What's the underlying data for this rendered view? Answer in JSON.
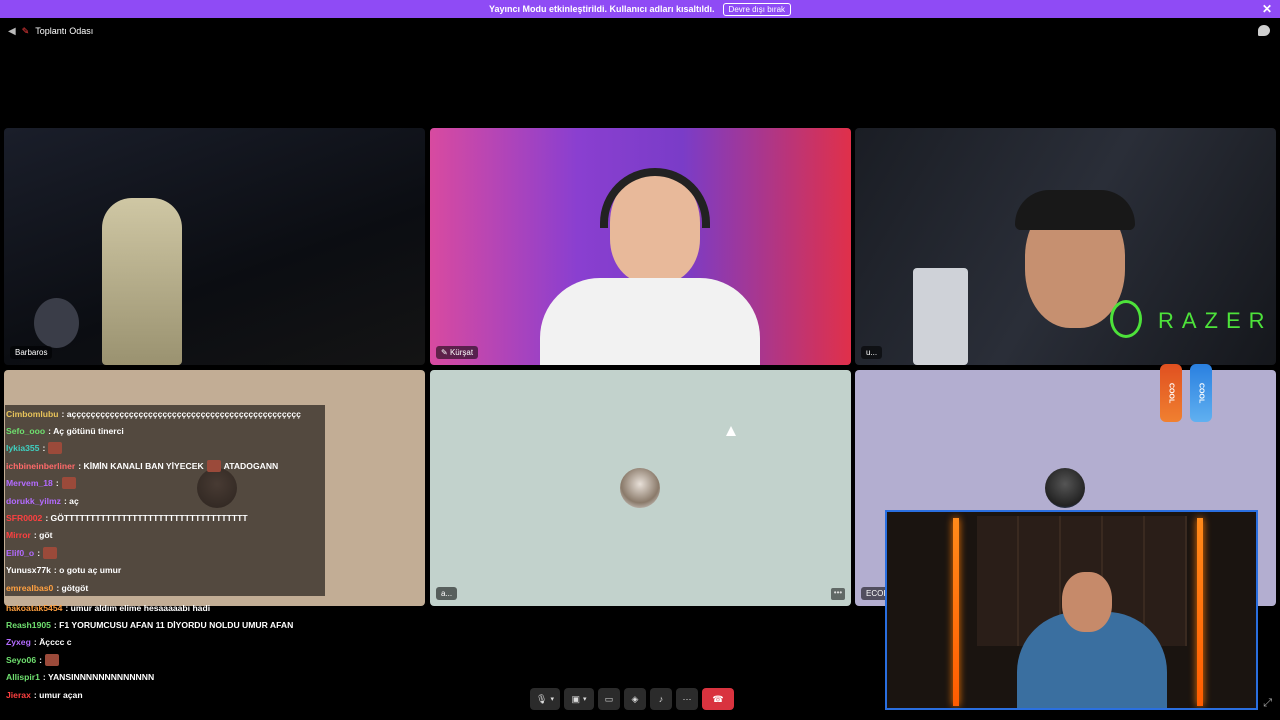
{
  "banner": {
    "text": "Yayıncı Modu etkinleştirildi. Kullanıcı adları kısaltıldı.",
    "button_label": "Devre dışı bırak",
    "color": "#8f4bf5"
  },
  "topbar": {
    "channel_name": "Toplantı Odası",
    "icons": [
      "speaker-muted-icon",
      "pin-icon",
      "chat-icon"
    ]
  },
  "tiles": [
    {
      "name": "Barbaros"
    },
    {
      "name": "Kürşat"
    },
    {
      "name": "u..."
    },
    {
      "name": ""
    },
    {
      "name": "a..."
    },
    {
      "name": "ECOIY"
    }
  ],
  "overlay": {
    "razer_text": "RAZER",
    "can_label_1": "COOL",
    "can_label_2": "COOL"
  },
  "chat_inside": [
    {
      "user": "Cimbomlubu",
      "color": "#e8c35a",
      "msg": ": açççççççççççççççççççççççççççççççççççççççççççççççç"
    },
    {
      "user": "Sefo_ooo",
      "color": "#6fe06f",
      "msg": ": Aç götünü tinerci"
    },
    {
      "user": "lykia355",
      "color": "#3fd0c0",
      "msg": ":",
      "emote": true
    },
    {
      "user": "ichbineinberliner",
      "color": "#ff6a6a",
      "msg": ": KİMİN KANALI BAN YİYECEK",
      "emote": true,
      "msg2": "ATADOGANN"
    },
    {
      "user": "Mervem_18",
      "color": "#b36bff",
      "msg": ":",
      "emote": true
    },
    {
      "user": "dorukk_yilmz",
      "color": "#b36bff",
      "msg": ": aç"
    },
    {
      "user": "SFR0002",
      "color": "#ff4040",
      "msg": ": GÖTTTTTTTTTTTTTTTTTTTTTTTTTTTTTTTTTTT"
    },
    {
      "user": "Mirror",
      "color": "#ff4040",
      "msg": ": göt"
    },
    {
      "user": "Elif0_o",
      "color": "#b36bff",
      "msg": ":",
      "emote": true
    },
    {
      "user": "Yunusx77k",
      "color": "#ffffff",
      "msg": ": o gotu aç umur"
    },
    {
      "user": "emrealbas0",
      "color": "#ffa040",
      "msg": ": götgöt"
    }
  ],
  "chat_outside": [
    {
      "user": "hakoatak5454",
      "color": "#ffa040",
      "msg": ": umur aldım elime hesaaaaabı hadi"
    },
    {
      "user": "Reash1905",
      "color": "#6fe06f",
      "msg": ": F1 YORUMCUSU AFAN 11 DİYORDU NOLDU UMUR AFAN"
    },
    {
      "user": "Zyxeg",
      "color": "#b36bff",
      "msg": ": Äçccc c"
    },
    {
      "user": "Seyo06",
      "color": "#6fe06f",
      "msg": ":",
      "emote": true
    },
    {
      "user": "Allispir1",
      "color": "#6fe06f",
      "msg": ": YANSINNNNNNNNNNNNN"
    },
    {
      "user": "Jierax",
      "color": "#ff4040",
      "msg": ": umur açan"
    }
  ],
  "controls": [
    "microphone-icon",
    "chevron-icon",
    "camera-off-icon",
    "chevron-icon",
    "screen-share-icon",
    "activity-icon",
    "soundboard-icon",
    "more-icon",
    "hang-up-icon"
  ]
}
